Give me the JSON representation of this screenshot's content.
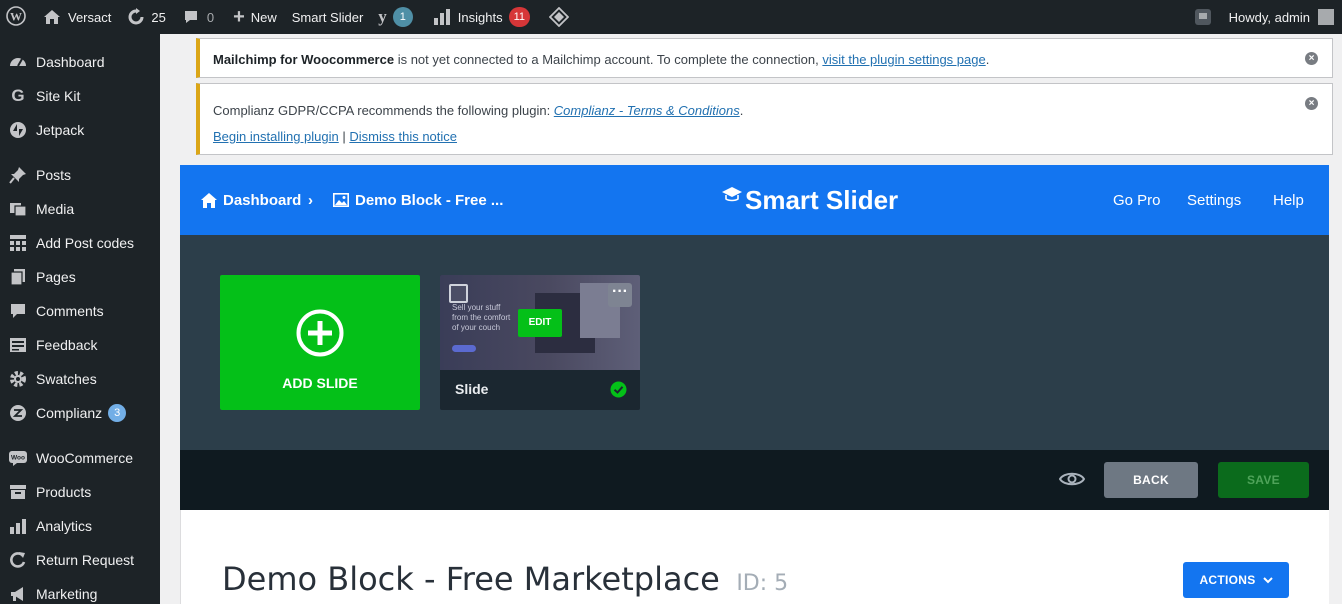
{
  "adminbar": {
    "site_name": "Versact",
    "updates_count": "25",
    "comments_count": "0",
    "new_label": "New",
    "smart_slider_label": "Smart Slider",
    "yoast_badge": "1",
    "insights_label": "Insights",
    "insights_badge": "11",
    "howdy": "Howdy, admin"
  },
  "sidebar": {
    "items": [
      {
        "label": "Dashboard",
        "icon": "dashboard-icon"
      },
      {
        "label": "Site Kit",
        "icon": "google-icon"
      },
      {
        "label": "Jetpack",
        "icon": "jetpack-icon"
      },
      {
        "label": "Posts",
        "icon": "pin-icon"
      },
      {
        "label": "Media",
        "icon": "media-icon"
      },
      {
        "label": "Add Post codes",
        "icon": "grid-icon"
      },
      {
        "label": "Pages",
        "icon": "pages-icon"
      },
      {
        "label": "Comments",
        "icon": "comment-icon"
      },
      {
        "label": "Feedback",
        "icon": "feedback-icon"
      },
      {
        "label": "Swatches",
        "icon": "gear-icon"
      },
      {
        "label": "Complianz",
        "icon": "complianz-icon",
        "count": "3"
      },
      {
        "label": "WooCommerce",
        "icon": "woo-icon"
      },
      {
        "label": "Products",
        "icon": "box-icon"
      },
      {
        "label": "Analytics",
        "icon": "bar-chart-icon"
      },
      {
        "label": "Return Request",
        "icon": "return-icon"
      },
      {
        "label": "Marketing",
        "icon": "megaphone-icon"
      }
    ]
  },
  "notices": {
    "mailchimp": {
      "strong": "Mailchimp for Woocommerce",
      "text": " is not yet connected to a Mailchimp account. To complete the connection, ",
      "link": "visit the plugin settings page",
      "end": "."
    },
    "complianz": {
      "text": "Complianz GDPR/CCPA recommends the following plugin: ",
      "link": "Complianz - Terms & Conditions",
      "end": ".",
      "begin_link": "Begin installing plugin",
      "separator": " | ",
      "dismiss_link": "Dismiss this notice"
    }
  },
  "ss_header": {
    "crumb_dashboard": "Dashboard",
    "crumb_slider": "Demo Block - Free ...",
    "logo_text": "Smart Slider",
    "go_pro": "Go Pro",
    "settings": "Settings",
    "help": "Help"
  },
  "slides": {
    "add_label": "ADD SLIDE",
    "slide_name": "Slide",
    "edit_label": "EDIT",
    "thumb_text": [
      "Sell your stuff",
      "from the comfort",
      "of your couch"
    ]
  },
  "action_bar": {
    "back_label": "BACK",
    "save_label": "SAVE"
  },
  "content": {
    "title": "Demo Block - Free Marketplace",
    "id_label": "ID: 5",
    "actions_label": "ACTIONS"
  },
  "colors": {
    "wp_dark": "#1d2327",
    "ss_blue": "#1375f0",
    "add_green": "#04c018",
    "save_green": "#0b6b1c",
    "notice_warning": "#dba617"
  }
}
